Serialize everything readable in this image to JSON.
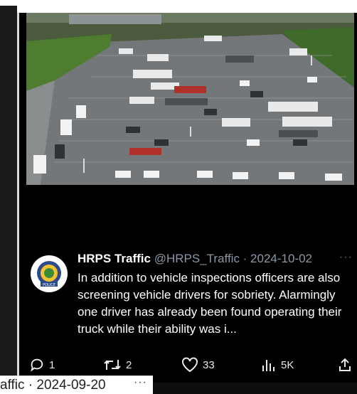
{
  "tweet": {
    "display_name": "HRPS Traffic",
    "handle_date": "@HRPS_Traffic · 2024-10-02",
    "more_label": "···",
    "text": "In addition to vehicle inspections officers are also screening vehicle drivers for sobriety. Alarmingly one driver has already been found operating their truck while their ability was i...",
    "avatar_text": "POLICE"
  },
  "actions": {
    "replies": "1",
    "reposts": "2",
    "likes": "33",
    "views": "5K"
  },
  "icons": {
    "reply": "reply-icon",
    "repost": "repost-icon",
    "like": "heart-icon",
    "views": "views-icon",
    "share": "share-icon"
  },
  "next_tweet_peek": {
    "text": "affic · 2024-09-20",
    "more_label": "···"
  },
  "colors": {
    "background": "#000000",
    "text": "#ffffff",
    "muted": "#8b98a5"
  }
}
